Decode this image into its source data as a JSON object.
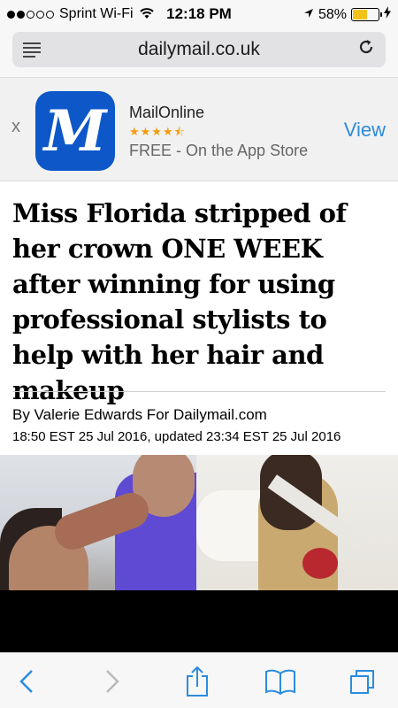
{
  "status_bar": {
    "carrier": "Sprint Wi-Fi",
    "time": "12:18 PM",
    "battery_percent": "58%",
    "battery_level": 0.58,
    "signal_bars_filled": 2,
    "signal_bars_total": 5,
    "battery_color": "#f2c31b"
  },
  "url_bar": {
    "url": "dailymail.co.uk",
    "reader_icon": "reader-icon",
    "reload_icon": "reload-icon"
  },
  "app_banner": {
    "close_label": "x",
    "icon_letter": "M",
    "app_name": "MailOnline",
    "rating_stars": "★★★★⯪",
    "subtitle": "FREE - On the App Store",
    "view_label": "View",
    "icon_color": "#0d57c9",
    "view_color": "#2b8cde"
  },
  "article": {
    "headline": "Miss Florida stripped of her crown ONE WEEK after winning for using professional stylists to help with her hair and makeup",
    "byline": "By Valerie Edwards For Dailymail.com",
    "dateline": "18:50 EST 25 Jul 2016, updated 23:34 EST 25 Jul 2016"
  },
  "toolbar": {
    "back_icon": "back-icon",
    "forward_icon": "forward-icon",
    "share_icon": "share-icon",
    "bookmarks_icon": "bookmarks-icon",
    "tabs_icon": "tabs-icon",
    "icon_color": "#2b8cde"
  }
}
